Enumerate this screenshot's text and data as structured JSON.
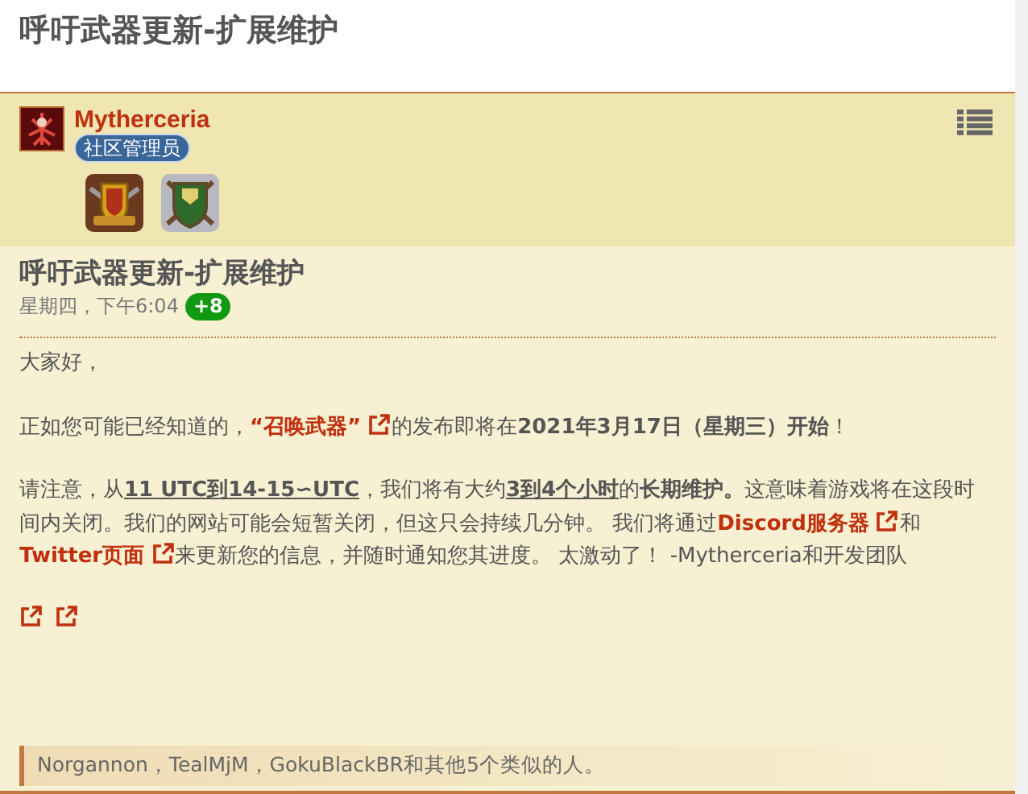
{
  "page_title": "呼吁武器更新-扩展维护",
  "post": {
    "author": {
      "name": "Mytherceria",
      "role": "社区管理员"
    },
    "title": "呼吁武器更新-扩展维护",
    "time": "星期四，下午6:04",
    "score": "+8",
    "paragraphs": [
      [
        {
          "kind": "text",
          "text": "大家好，"
        }
      ],
      [
        {
          "kind": "text",
          "text": "正如您可能已经知道的，"
        },
        {
          "kind": "link",
          "text": "“召唤武器”"
        },
        {
          "kind": "ext-icon"
        },
        {
          "kind": "text",
          "text": "的发布即将在**2021年3月17日（星期三）开始**！"
        }
      ],
      [
        {
          "kind": "text",
          "text": "请注意，从"
        },
        {
          "kind": "strong-underline",
          "text": "11 UTC到14-15∽UTC"
        },
        {
          "kind": "text",
          "text": "，我们将有大约"
        },
        {
          "kind": "strong-underline",
          "text": "3到4个小时"
        },
        {
          "kind": "text",
          "text": "的**长期维护。**这意味着游戏将在这段时间内关闭。我们的网站可能会短暂关闭，但这只会持续几分钟。 我们将通过"
        },
        {
          "kind": "link",
          "text": "Discord服务器"
        },
        {
          "kind": "ext-icon"
        },
        {
          "kind": "text",
          "text": "和"
        },
        {
          "kind": "link",
          "text": "Twitter页面"
        },
        {
          "kind": "ext-icon"
        },
        {
          "kind": "text",
          "text": "来更新您的信息，并随时通知您其进度。 太激动了！ -Mytherceria和开发团队"
        }
      ],
      [
        {
          "kind": "ext-icon"
        },
        {
          "kind": "ext-icon"
        }
      ]
    ],
    "reactions": "Norgannon，TealMjM，GokuBlackBR和其他5个类似的人。"
  }
}
